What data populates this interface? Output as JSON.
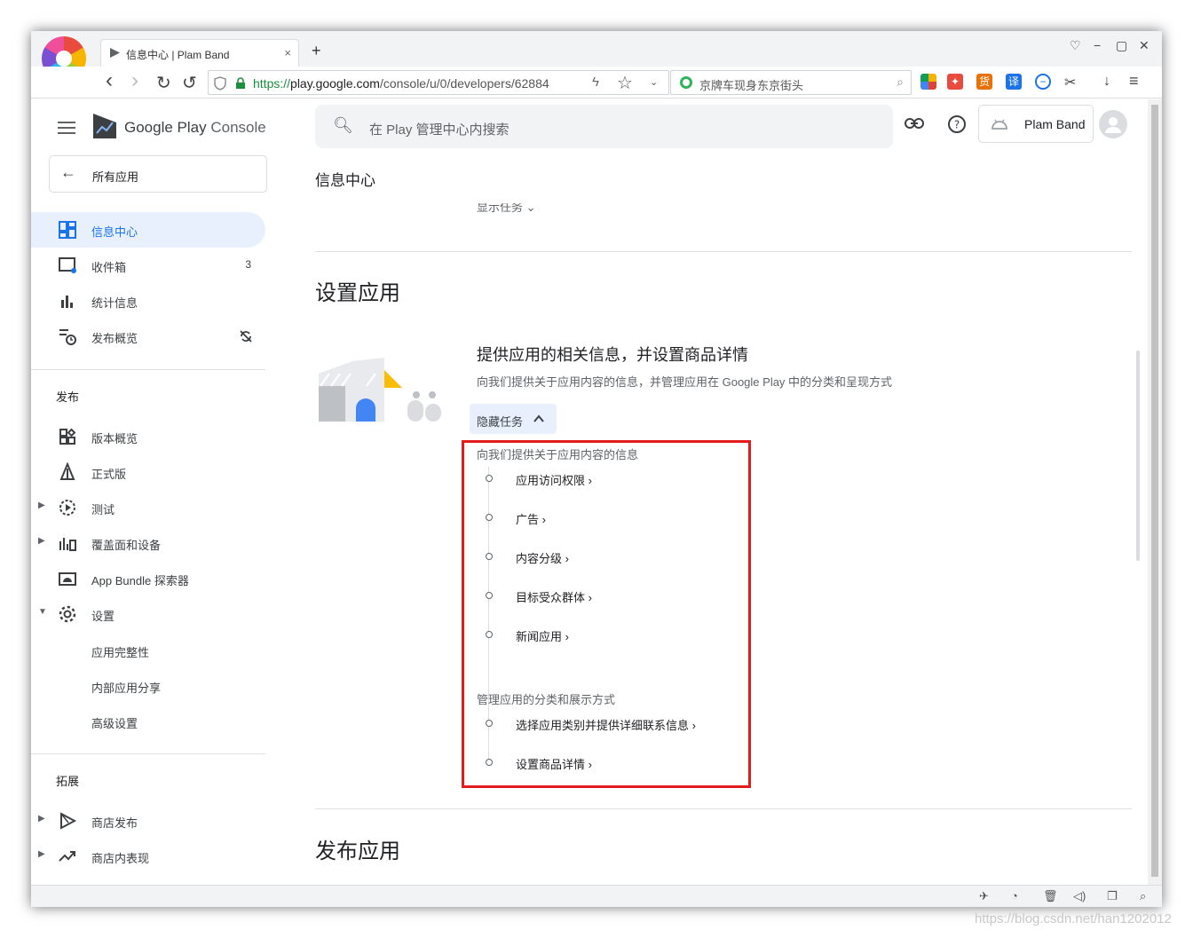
{
  "browser": {
    "tab_title": "信息中心 | Plam Band",
    "tab_close": "×",
    "new_tab": "+",
    "url_https": "https://",
    "url_host": "play.google.com",
    "url_path": "/console/u/0/developers/62884",
    "search_text": "京牌车现身东京街头",
    "nav_back": "‹",
    "nav_forward": "›",
    "nav_reload": "↻",
    "nav_undo": "↺",
    "window_minimize": "−",
    "window_maximize": "▢",
    "window_close": "✕"
  },
  "app": {
    "brand_google": "Google Play",
    "brand_console": " Console",
    "all_apps": "所有应用",
    "search_placeholder": "在 Play 管理中心内搜索",
    "account_name": "Plam Band",
    "page_title": "信息中心",
    "faded_task": "显示任务"
  },
  "sidebar": {
    "items": [
      {
        "label": "信息中心",
        "icon": "dashboard-icon"
      },
      {
        "label": "收件箱",
        "badge": "3",
        "icon": "inbox-icon"
      },
      {
        "label": "统计信息",
        "icon": "bar-chart-icon"
      },
      {
        "label": "发布概览",
        "icon": "publishing-icon"
      }
    ],
    "release_header": "发布",
    "release_items": [
      {
        "label": "版本概览"
      },
      {
        "label": "正式版"
      },
      {
        "label": "测试"
      },
      {
        "label": "覆盖面和设备"
      },
      {
        "label": "App Bundle 探索器"
      },
      {
        "label": "设置"
      }
    ],
    "settings_subitems": [
      "应用完整性",
      "内部应用分享",
      "高级设置"
    ],
    "grow_header": "拓展",
    "grow_items": [
      {
        "label": "商店发布"
      },
      {
        "label": "商店内表现"
      }
    ]
  },
  "main": {
    "section_setup": "设置应用",
    "card_title": "提供应用的相关信息，并设置商品详情",
    "card_desc": "向我们提供关于应用内容的信息，并管理应用在 Google Play 中的分类和呈现方式",
    "hide_tasks": "隐藏任务",
    "group1_label": "向我们提供关于应用内容的信息",
    "group1_tasks": [
      "应用访问权限 ›",
      "广告 ›",
      "内容分级 ›",
      "目标受众群体 ›",
      "新闻应用 ›"
    ],
    "group2_label": "管理应用的分类和展示方式",
    "group2_tasks": [
      "选择应用类别并提供详细联系信息 ›",
      "设置商品详情 ›"
    ],
    "section_publish": "发布应用"
  },
  "watermark": "https://blog.csdn.net/han1202012"
}
